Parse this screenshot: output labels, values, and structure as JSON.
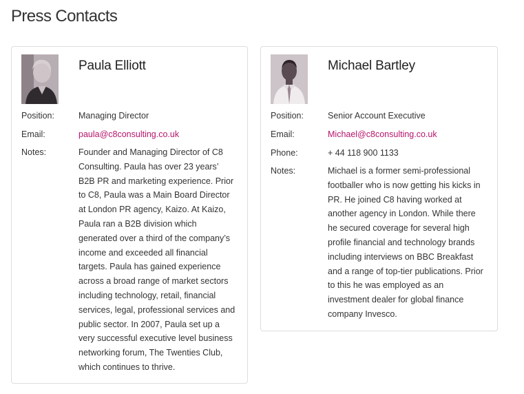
{
  "page": {
    "title": "Press Contacts"
  },
  "labels": {
    "position": "Position:",
    "email": "Email:",
    "phone": "Phone:",
    "notes": "Notes:"
  },
  "contacts": [
    {
      "name": "Paula Elliott",
      "photo_icon": "person-photo-icon",
      "position": "Managing Director",
      "email": "paula@c8consulting.co.uk",
      "notes_lines": [
        "Founder and Managing Director of C8",
        "Consulting. Paula has over 23 years’",
        "B2B PR and marketing experience. Prior",
        "to C8, Paula was a Main Board Director",
        "at London PR agency, Kaizo. At Kaizo,",
        "Paula ran a B2B division which",
        "generated over a third of the company’s",
        "income and exceeded all financial",
        "targets. Paula has gained experience",
        "across a broad range of market sectors",
        "including technology, retail, financial",
        "services, legal, professional services and",
        "public sector. In 2007, Paula set up a",
        "very successful executive level business",
        "networking forum, The Twenties Club,",
        "which continues to thrive."
      ]
    },
    {
      "name": "Michael Bartley",
      "photo_icon": "person-photo-icon",
      "position": "Senior Account Executive",
      "email": "Michael@c8consulting.co.uk",
      "phone": "+ 44 118 900 1133",
      "notes_lines": [
        "Michael is a former semi-professional",
        "footballer who is now getting his kicks in",
        "PR. He joined C8 having worked at",
        "another agency in London. While there",
        "he secured coverage for several high",
        "profile financial and technology brands",
        "including interviews on BBC Breakfast",
        "and a range of top-tier publications. Prior",
        "to this he was employed as an",
        "investment dealer for global finance",
        "company Invesco."
      ]
    }
  ],
  "colors": {
    "link": "#b5146b",
    "card_border": "#dddddd",
    "text": "#333333"
  }
}
